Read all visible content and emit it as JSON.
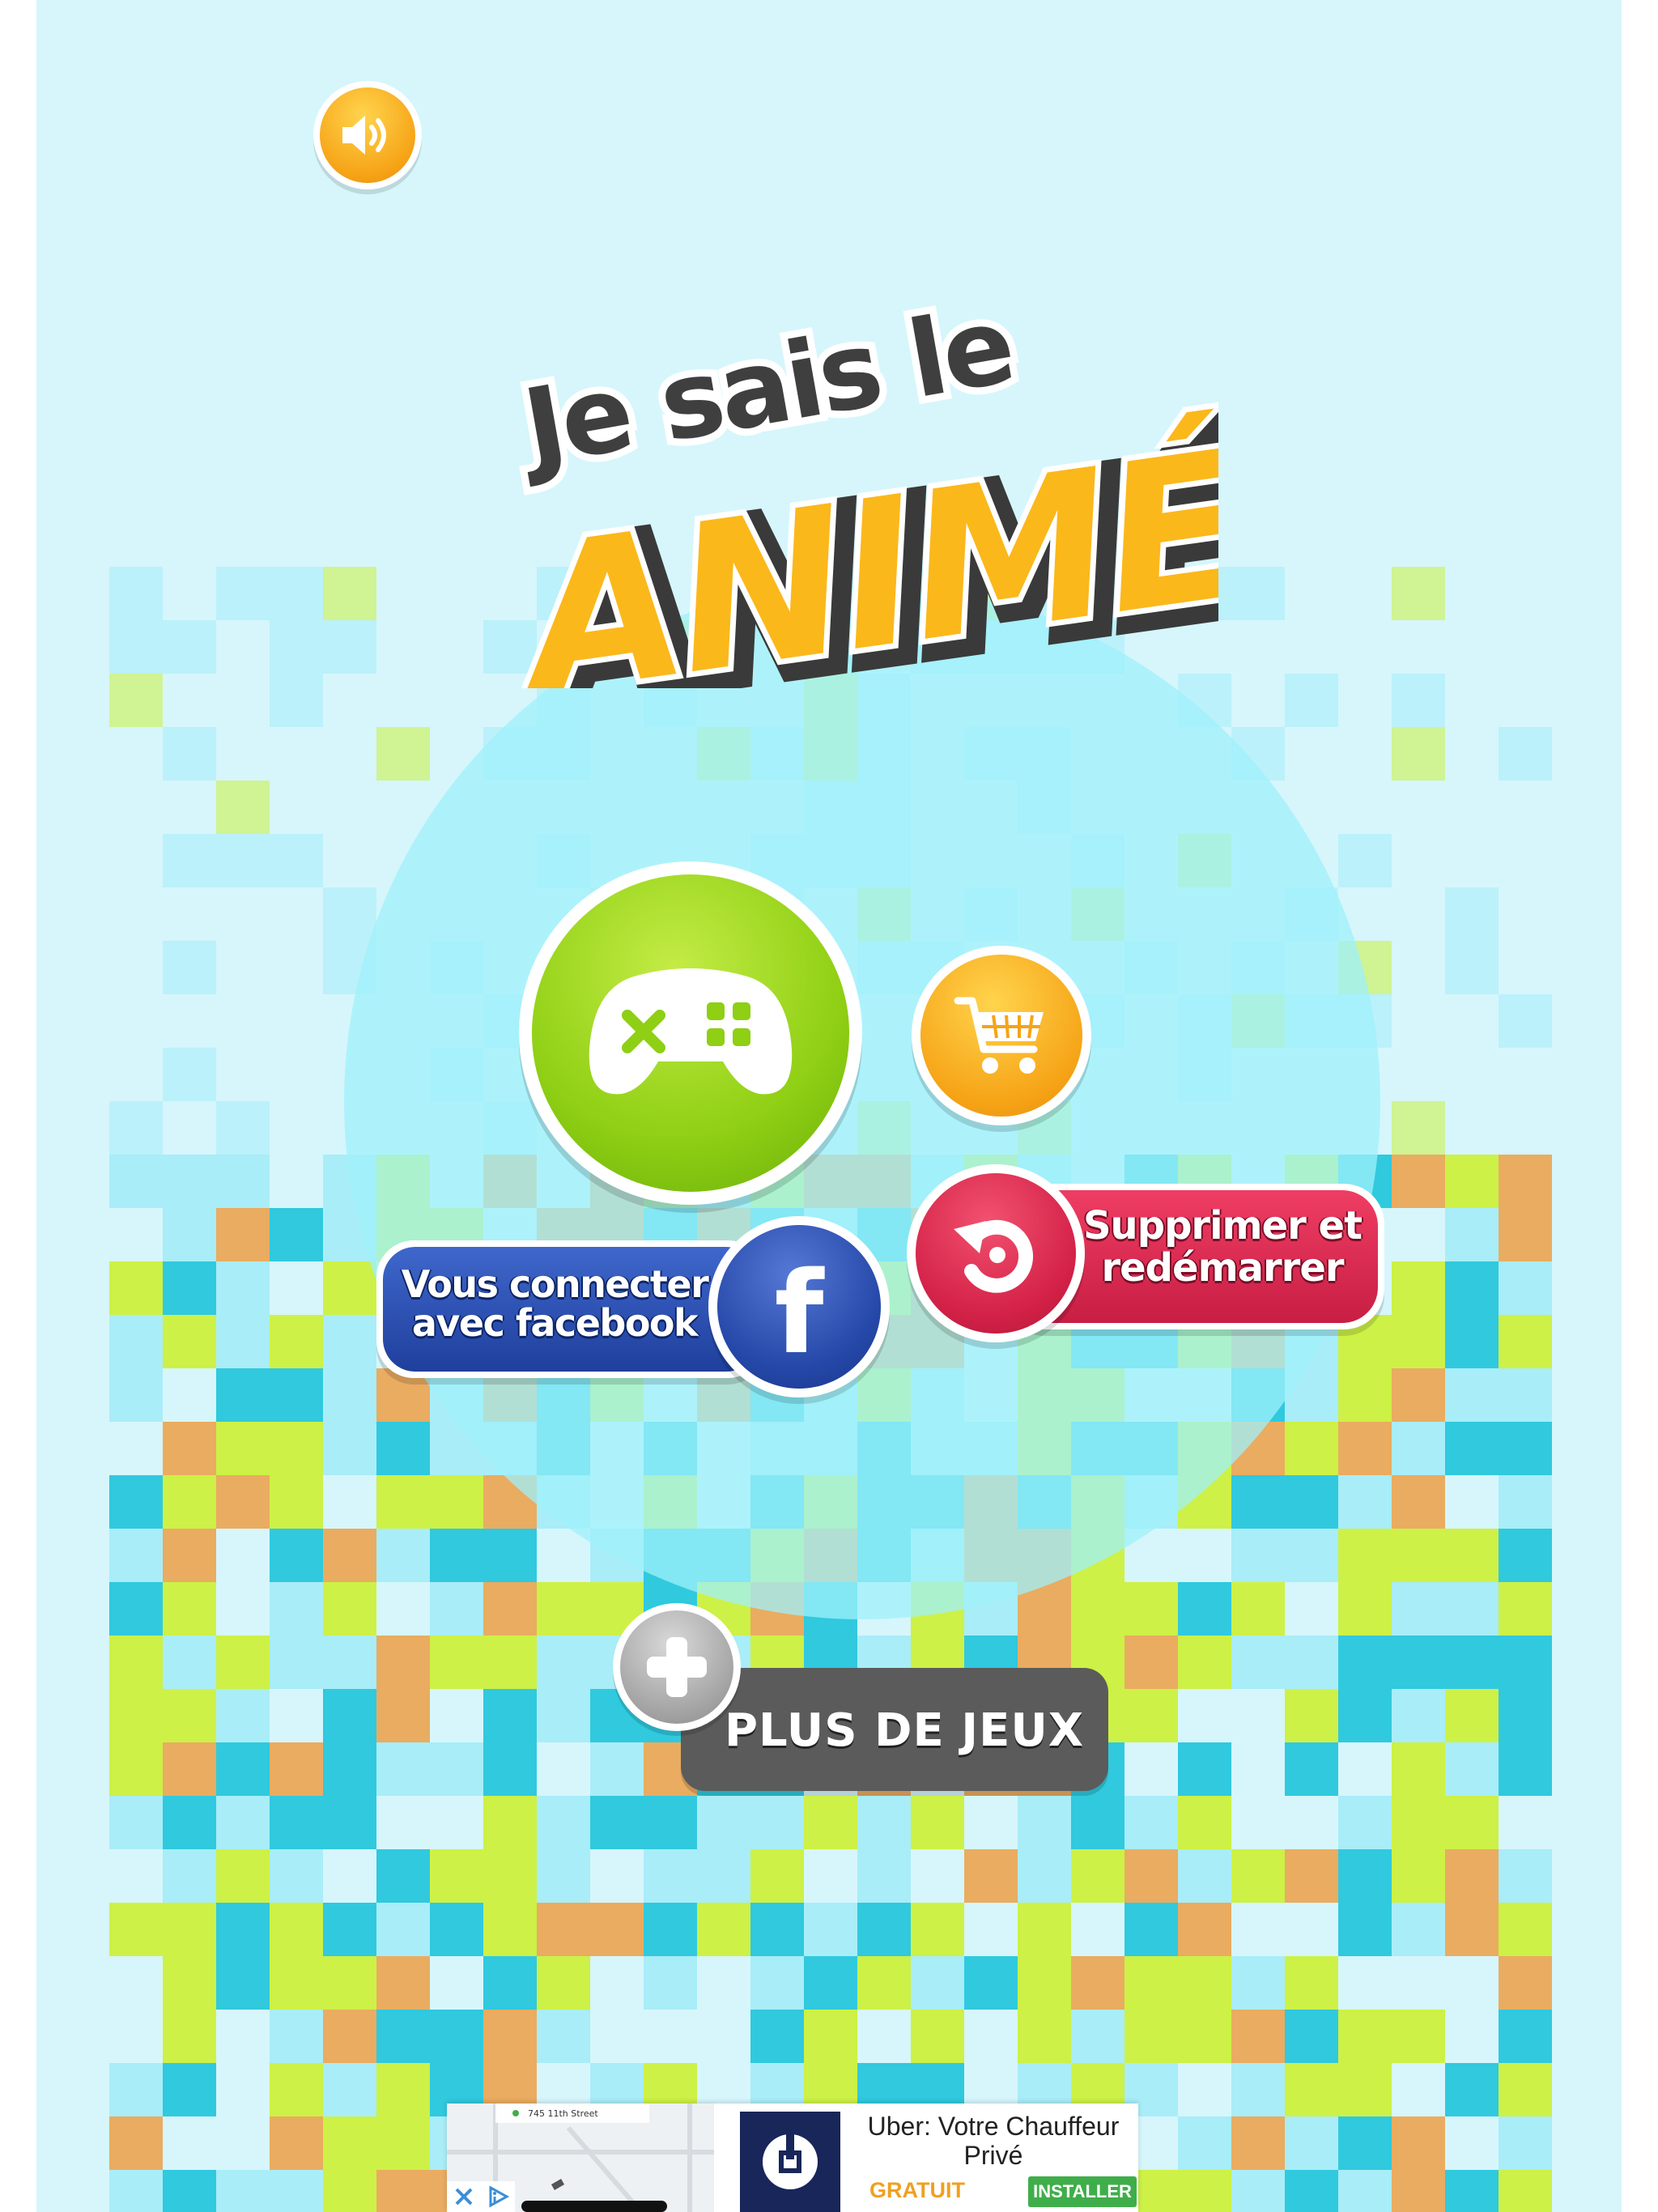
{
  "colors": {
    "background": "#d6f6fc",
    "circle_glow": "#9ff0fb",
    "tile_cyan": "#27c6dc",
    "tile_lime": "#ccf03c",
    "tile_orange": "#eaa858",
    "tile_light": "#a6ecf8",
    "title_yellow": "#fbb81b",
    "title_dark": "#3f3f3f"
  },
  "logo": {
    "line1": "Je sais le",
    "line2": "ANIMÉ"
  },
  "icons": {
    "sound": "speaker-icon",
    "play": "gamepad-icon",
    "shop": "cart-icon",
    "reset": "restart-icon",
    "facebook": "facebook-icon",
    "more": "plus-icon"
  },
  "buttons": {
    "facebook_line1": "Vous connecter",
    "facebook_line2": "avec facebook",
    "facebook_letter": "f",
    "reset_line1": "Supprimer et",
    "reset_line2": "redémarrer",
    "more_games": "PLUS DE JEUX"
  },
  "ad": {
    "title": "Uber: Votre Chauffeur Privé",
    "price": "GRATUIT",
    "install": "INSTALLER",
    "map_street": "745 11th Street"
  }
}
